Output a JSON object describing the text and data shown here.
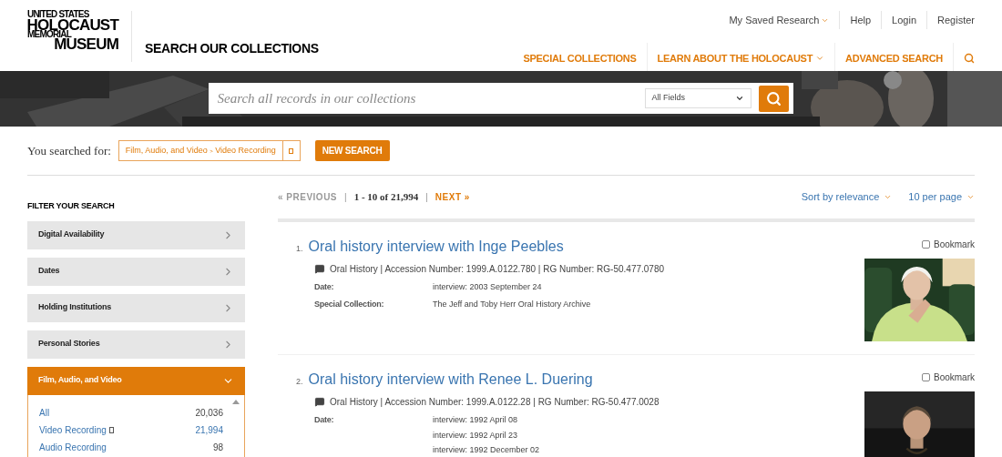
{
  "header": {
    "logo_lines": [
      "UNITED STATES",
      "HOLOCAUST",
      "MEMORIAL",
      "MUSEUM"
    ],
    "title": "SEARCH OUR COLLECTIONS",
    "utility_links": [
      {
        "label": "My Saved Research",
        "dropdown": true
      },
      {
        "label": "Help",
        "dropdown": false
      },
      {
        "label": "Login",
        "dropdown": false
      },
      {
        "label": "Register",
        "dropdown": false
      }
    ],
    "nav": [
      {
        "label": "SPECIAL COLLECTIONS",
        "dropdown": false
      },
      {
        "label": "LEARN ABOUT THE HOLOCAUST",
        "dropdown": true
      },
      {
        "label": "ADVANCED SEARCH",
        "dropdown": false
      }
    ]
  },
  "search": {
    "placeholder": "Search all records in our collections",
    "field_select": "All Fields"
  },
  "query": {
    "label": "You searched for:",
    "tag_parts": [
      "Film, Audio, and Video",
      "Video Recording"
    ],
    "separator": ">",
    "new_search": "NEW SEARCH"
  },
  "filters": {
    "title": "FILTER YOUR SEARCH",
    "items": [
      {
        "label": "Digital Availability",
        "expanded": false
      },
      {
        "label": "Dates",
        "expanded": false
      },
      {
        "label": "Holding Institutions",
        "expanded": false
      },
      {
        "label": "Personal Stories",
        "expanded": false
      },
      {
        "label": "Film, Audio, and Video",
        "expanded": true,
        "options": [
          {
            "label": "All",
            "count": "20,036",
            "selected": false
          },
          {
            "label": "Video Recording",
            "count": "21,994",
            "selected": true
          },
          {
            "label": "Audio Recording",
            "count": "98",
            "selected": false
          }
        ]
      }
    ]
  },
  "pagination": [
    {
      "kind": "disabled-link",
      "text": "« PREVIOUS"
    },
    {
      "kind": "separator",
      "text": "|"
    },
    {
      "kind": "range",
      "text": "1 - 10 of 21,994"
    },
    {
      "kind": "separator",
      "text": "|"
    },
    {
      "kind": "link",
      "text": "NEXT »"
    }
  ],
  "sort_controls": [
    "Sort by relevance",
    "10 per page"
  ],
  "results": [
    {
      "number": "1.",
      "title": "Oral history interview with Inge Peebles",
      "meta": "Oral History | Accession Number: 1999.A.0122.780 | RG Number: RG-50.477.0780",
      "fields": [
        {
          "label": "Date:",
          "values": [
            "interview: 2003 September 24"
          ]
        },
        {
          "label": "Special Collection:",
          "values": [
            "The Jeff and Toby Herr Oral History Archive"
          ]
        }
      ],
      "bookmark": {
        "label": "Bookmark",
        "checked": false
      }
    },
    {
      "number": "2.",
      "title": "Oral history interview with Renee L. Duering",
      "meta": "Oral History | Accession Number: 1999.A.0122.28 | RG Number: RG-50.477.0028",
      "fields": [
        {
          "label": "Date:",
          "values": [
            "interview: 1992 April 08",
            "interview: 1992 April 23",
            "interview: 1992 December 02"
          ]
        }
      ],
      "bookmark": {
        "label": "Bookmark",
        "checked": false
      }
    }
  ]
}
